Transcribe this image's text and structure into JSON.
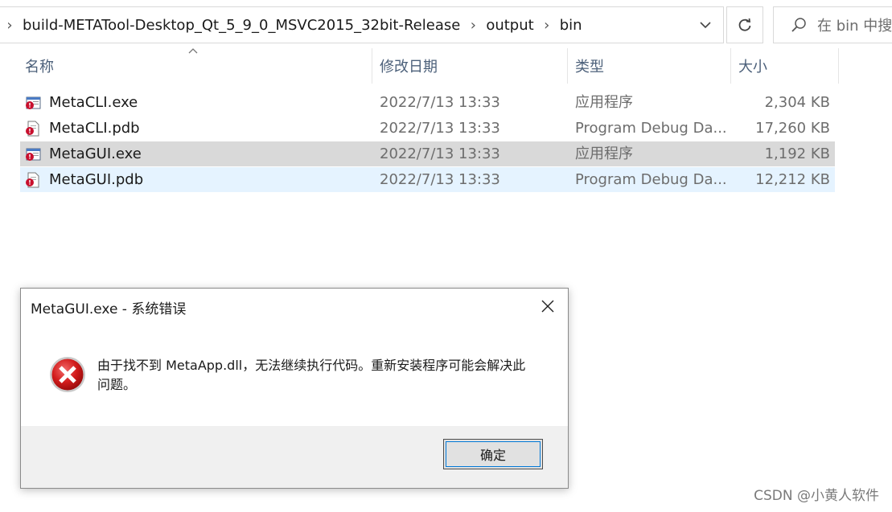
{
  "address_bar": {
    "crumbs": [
      "build-METATool-Desktop_Qt_5_9_0_MSVC2015_32bit-Release",
      "output",
      "bin"
    ],
    "dropdown_icon": "chevron-down-icon",
    "refresh_icon": "refresh-icon"
  },
  "search": {
    "placeholder": "在 bin 中搜",
    "icon": "search-icon"
  },
  "columns": {
    "name": "名称",
    "date": "修改日期",
    "type": "类型",
    "size": "大小"
  },
  "files": [
    {
      "name": "MetaCLI.exe",
      "date": "2022/7/13 13:33",
      "type": "应用程序",
      "size": "2,304 KB",
      "icon": "exe-icon"
    },
    {
      "name": "MetaCLI.pdb",
      "date": "2022/7/13 13:33",
      "type": "Program Debug Da...",
      "size": "17,260 KB",
      "icon": "pdb-icon"
    },
    {
      "name": "MetaGUI.exe",
      "date": "2022/7/13 13:33",
      "type": "应用程序",
      "size": "1,192 KB",
      "icon": "exe-icon"
    },
    {
      "name": "MetaGUI.pdb",
      "date": "2022/7/13 13:33",
      "type": "Program Debug Da...",
      "size": "12,212 KB",
      "icon": "pdb-icon"
    }
  ],
  "dialog": {
    "title": "MetaGUI.exe - 系统错误",
    "message": "由于找不到 MetaApp.dll，无法继续执行代码。重新安装程序可能会解决此问题。",
    "ok_label": "确定",
    "icon": "error-icon"
  },
  "watermark": "CSDN @小黄人软件"
}
